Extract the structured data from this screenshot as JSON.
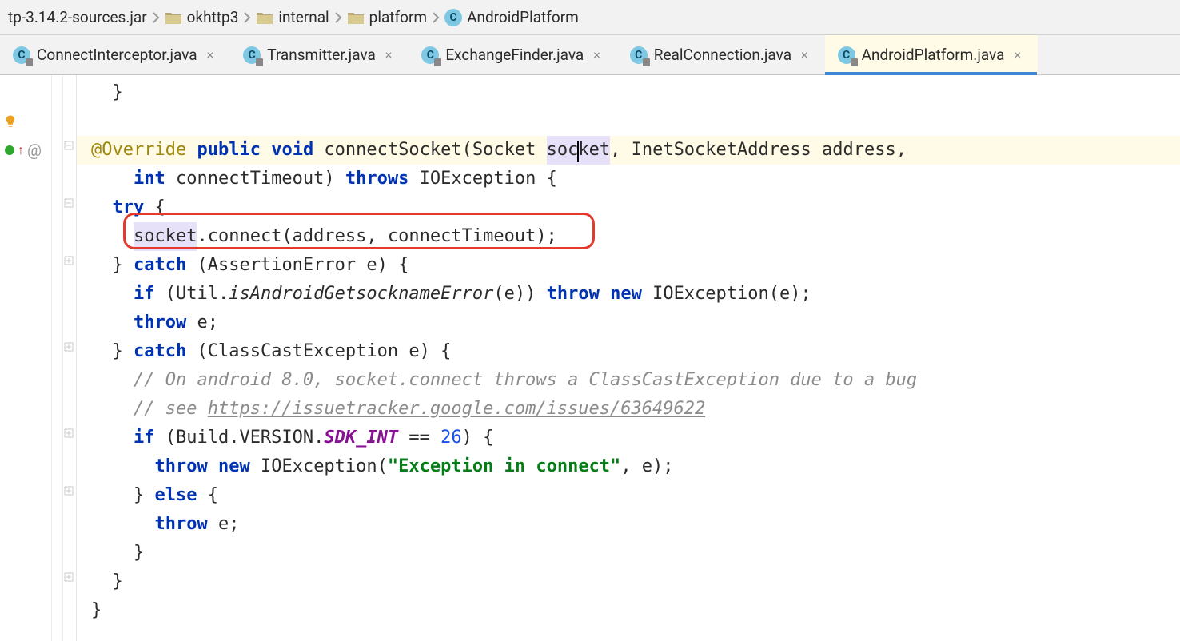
{
  "breadcrumbs": [
    {
      "label": "tp-3.14.2-sources.jar",
      "kind": "plain"
    },
    {
      "label": "okhttp3",
      "kind": "folder"
    },
    {
      "label": "internal",
      "kind": "folder"
    },
    {
      "label": "platform",
      "kind": "folder"
    },
    {
      "label": "AndroidPlatform",
      "kind": "class"
    }
  ],
  "tabs": [
    {
      "label": "ConnectInterceptor.java",
      "active": false
    },
    {
      "label": "Transmitter.java",
      "active": false
    },
    {
      "label": "ExchangeFinder.java",
      "active": false
    },
    {
      "label": "RealConnection.java",
      "active": false
    },
    {
      "label": "AndroidPlatform.java",
      "active": true
    }
  ],
  "class_icon_letter": "C",
  "code": {
    "l0": "  }",
    "l1": "",
    "sig1_ann": "@Override",
    "sig1_kw1": "public",
    "sig1_kw2": "void",
    "sig1_mid1": " connectSocket(Socket ",
    "sig1_var1a": "soc",
    "sig1_var1b": "ket",
    "sig1_mid2": ", InetSocketAddress address,",
    "sig2_kw": "int",
    "sig2_mid1": " connectTimeout) ",
    "sig2_kw2": "throws",
    "sig2_mid2": " IOException {",
    "try_kw": "try",
    "try_rest": " {",
    "conn_var": "socket",
    "conn_rest": ".connect(address, connectTimeout);",
    "catch1_pre": "} ",
    "catch1_kw": "catch",
    "catch1_rest": " (AssertionError e) {",
    "if1_pre": "  ",
    "if1_kw": "if",
    "if1_mid1": " (Util.",
    "if1_ital": "isAndroidGetsocknameError",
    "if1_mid2": "(e)) ",
    "if1_kw2": "throw",
    "if1_sp": " ",
    "if1_kw3": "new",
    "if1_mid3": " IOException(e);",
    "throw1_kw": "throw",
    "throw1_rest": " e;",
    "catch2_pre": "} ",
    "catch2_kw": "catch",
    "catch2_rest": " (ClassCastException e) {",
    "cmt1": "  // On android 8.0, socket.connect throws a ClassCastException due to a bug",
    "cmt2a": "  // see ",
    "cmt2b": "https://issuetracker.google.com/issues/63649622",
    "if2_kw": "if",
    "if2_mid1": " (Build.VERSION.",
    "if2_field": "SDK_INT",
    "if2_mid2": " == ",
    "if2_num": "26",
    "if2_mid3": ") {",
    "throw2_kw1": "throw",
    "throw2_sp": " ",
    "throw2_kw2": "new",
    "throw2_mid1": " IOException(",
    "throw2_str": "\"Exception in connect\"",
    "throw2_mid2": ", e);",
    "else_pre": "} ",
    "else_kw": "else",
    "else_rest": " {",
    "throw3_kw": "throw",
    "throw3_rest": " e;",
    "close1": "}",
    "close2": "}",
    "close3": "}"
  }
}
